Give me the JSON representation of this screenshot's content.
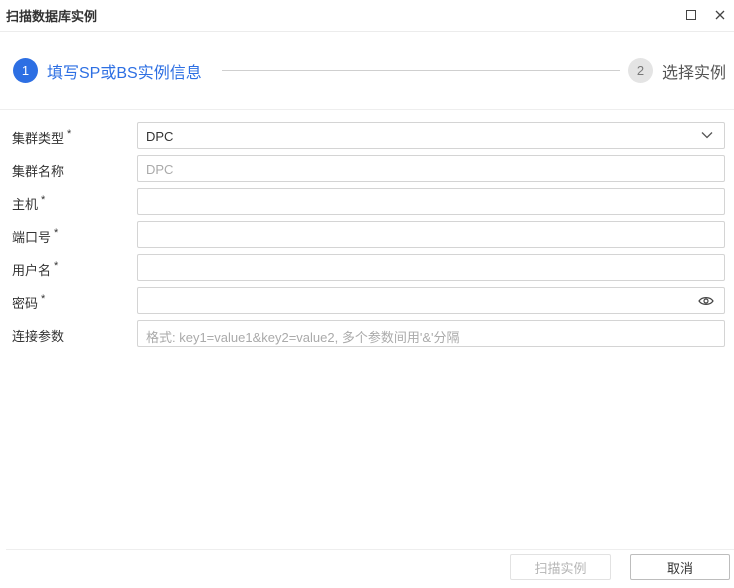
{
  "window": {
    "title": "扫描数据库实例",
    "maximize_icon": "maximize-icon",
    "close_icon": "close-icon"
  },
  "steps": [
    {
      "number": "1",
      "label": "填写SP或BS实例信息",
      "state": "active"
    },
    {
      "number": "2",
      "label": "选择实例",
      "state": "inactive"
    }
  ],
  "colors": {
    "accent": "#2d6fe3",
    "inactive_step": "#e4e4e4"
  },
  "form": {
    "cluster_type": {
      "label": "集群类型",
      "required": "*",
      "value": "DPC",
      "icon": "chevron-down-icon"
    },
    "cluster_name": {
      "label": "集群名称",
      "placeholder": "DPC"
    },
    "host": {
      "label": "主机",
      "required": "*",
      "value": ""
    },
    "port": {
      "label": "端口号",
      "required": "*",
      "value": ""
    },
    "username": {
      "label": "用户名",
      "required": "*",
      "value": ""
    },
    "password": {
      "label": "密码",
      "required": "*",
      "value": "",
      "icon": "eye-icon"
    },
    "conn_params": {
      "label": "连接参数",
      "placeholder": "格式: key1=value1&key2=value2, 多个参数间用'&'分隔"
    }
  },
  "footer": {
    "scan_label": "扫描实例",
    "cancel_label": "取消"
  }
}
